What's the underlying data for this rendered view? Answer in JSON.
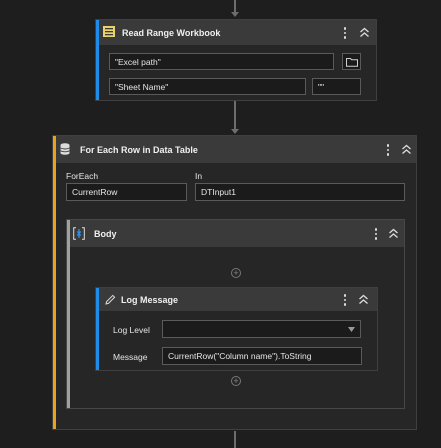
{
  "read_range": {
    "title": "Read Range Workbook",
    "path_value": "\"Excel path\"",
    "sheet_value": "\"Sheet Name\"",
    "range_value": "\"\""
  },
  "for_each": {
    "title": "For Each Row in Data Table",
    "foreach_label": "ForEach",
    "foreach_value": "CurrentRow",
    "in_label": "In",
    "in_value": "DTInput1"
  },
  "body_seq": {
    "title": "Body"
  },
  "log_message": {
    "title": "Log Message",
    "level_label": "Log Level",
    "level_value": "",
    "message_label": "Message",
    "message_value": "CurrentRow(\"Column name\").ToString"
  },
  "colors": {
    "canvas": "#1e1e1e",
    "selected_accent": "#1f8ceb",
    "container_accent": "#e8a317",
    "body_accent": "#a0a0a0",
    "excel_icon": "#e8d36a"
  },
  "icons": {
    "excel": "excel-workbook-icon",
    "datatable": "datatable-icon",
    "sequence": "sequence-icon",
    "log": "pencil-icon",
    "browse": "folder-icon",
    "menu": "kebab-icon",
    "collapse": "chevron-up-double-icon",
    "add": "plus-circle-icon",
    "dropdown": "triangle-down-icon"
  }
}
